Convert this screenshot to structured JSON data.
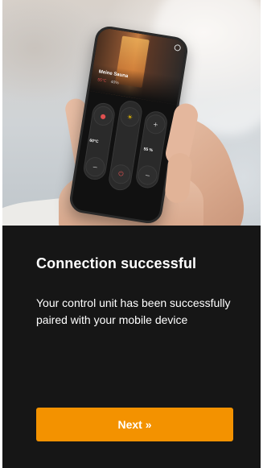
{
  "hero": {
    "phone_app": {
      "sauna_name": "Meine Sauna",
      "temperature": "55°C",
      "humidity": "40%",
      "left_setting": "60°C",
      "right_setting": "55 %",
      "plus_symbol": "+",
      "minus_symbol": "−"
    }
  },
  "content": {
    "title": "Connection successful",
    "message": "Your control unit has been successfully paired with your mobile device"
  },
  "actions": {
    "next_label": "Next »"
  },
  "colors": {
    "background": "#161616",
    "accent": "#f39200",
    "text": "#ffffff"
  }
}
